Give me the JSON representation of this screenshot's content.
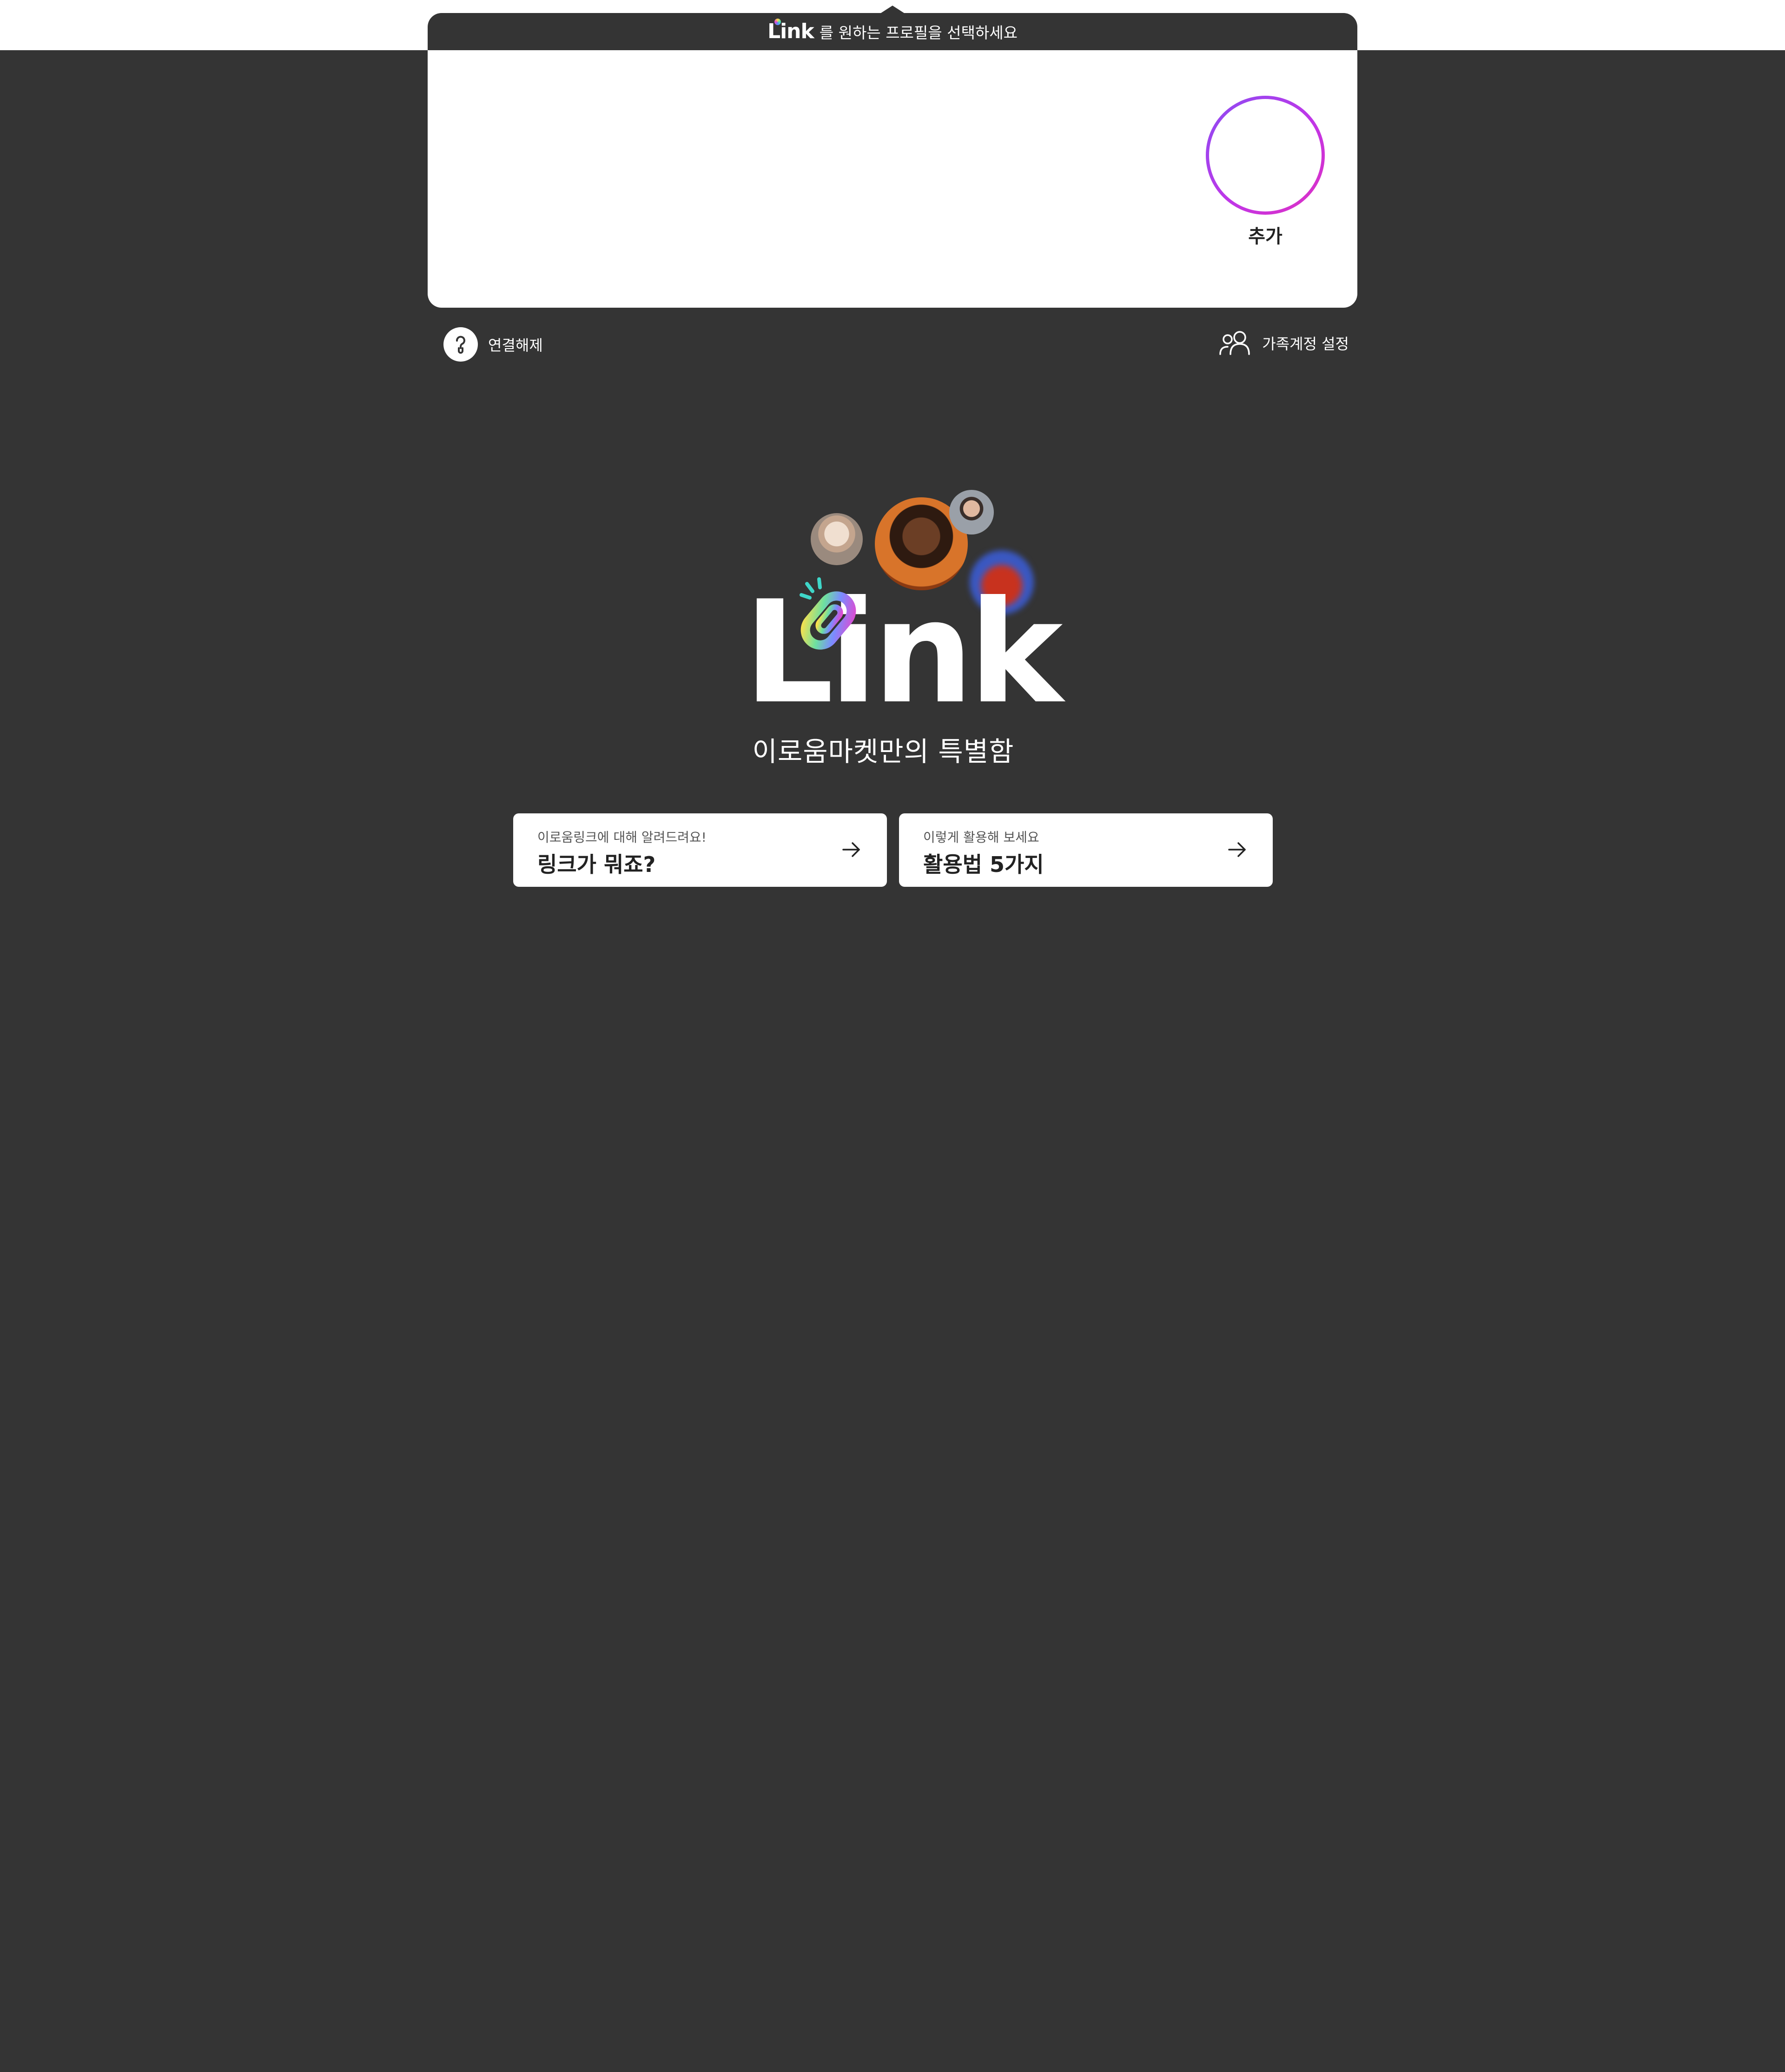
{
  "profile_popup": {
    "header_logo": "Link",
    "header_text": "를 원하는 프로필을 선택하세요",
    "add_label": "추가"
  },
  "secondary_actions": {
    "disconnect_label": "연결해제",
    "family_settings_label": "가족계정 설정"
  },
  "hero": {
    "logo_text": "Link",
    "tagline": "이로움마켓만의 특별함"
  },
  "cards": [
    {
      "subtitle": "이로움링크에 대해 알려드려요!",
      "title": "링크가 뭐죠?"
    },
    {
      "subtitle": "이렇게 활용해 보세요",
      "title": "활용법 5가지"
    }
  ],
  "colors": {
    "background": "#343434",
    "accent_gradient_start": "#8b4cf2",
    "accent_gradient_end": "#e02fc0",
    "card_background": "#ffffff"
  },
  "icons": {
    "add": "plus-icon",
    "disconnect": "question-link-icon",
    "family": "people-icon",
    "card_arrow": "arrow-right-icon"
  }
}
